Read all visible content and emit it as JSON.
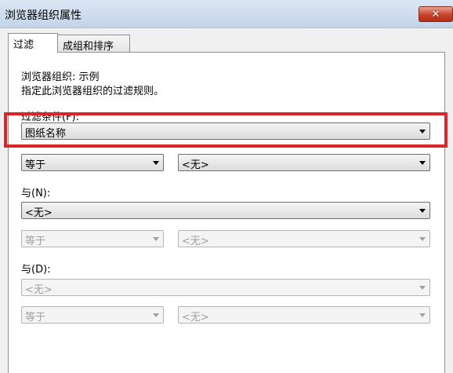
{
  "window": {
    "title": "浏览器组织属性",
    "close_glyph": "✕"
  },
  "tabs": [
    {
      "label": "过滤"
    },
    {
      "label": "成组和排序"
    }
  ],
  "info": {
    "line1": "浏览器组织: 示例",
    "line2": "指定此浏览器组织的过滤规则。"
  },
  "filter": {
    "label": "过滤条件(F):",
    "field": "图纸名称",
    "operator": "等于",
    "value": "<无>"
  },
  "and_n": {
    "label": "与(N):",
    "field": "<无>",
    "operator": "等于",
    "value": "<无>"
  },
  "and_d": {
    "label": "与(D):",
    "field": "<无>",
    "operator": "等于",
    "value": "<无>"
  },
  "colors": {
    "highlight": "#d9252b",
    "close_button": "#c9432a"
  }
}
